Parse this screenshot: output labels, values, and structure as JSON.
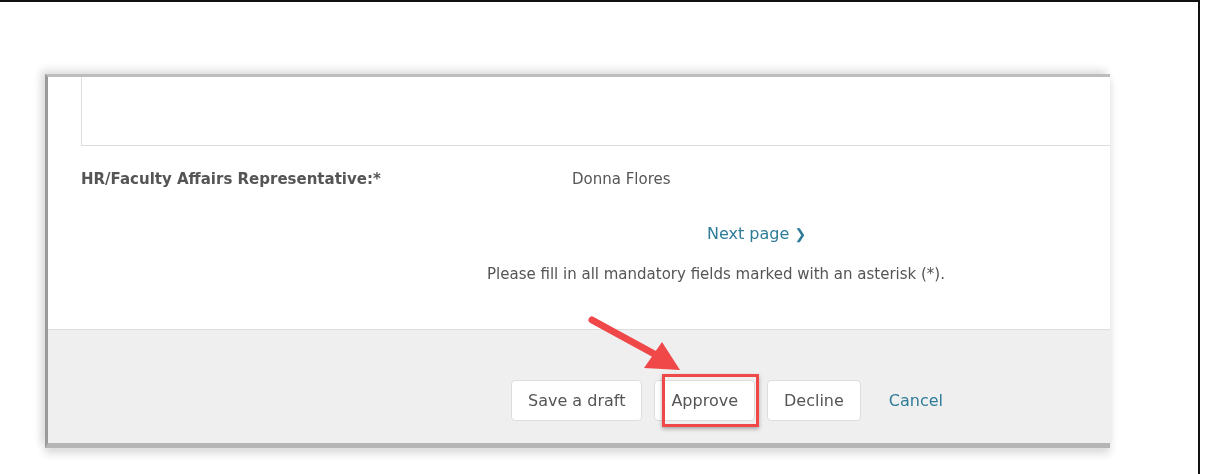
{
  "field": {
    "label": "HR/Faculty Affairs Representative:*",
    "value": "Donna Flores"
  },
  "next_page": {
    "label": "Next page",
    "icon": "❯"
  },
  "notice": "Please fill in all mandatory fields marked with an asterisk (*).",
  "actions": [
    {
      "label": "Save a draft",
      "kind": "button",
      "highlighted": false
    },
    {
      "label": "Approve",
      "kind": "button",
      "highlighted": true
    },
    {
      "label": "Decline",
      "kind": "button",
      "highlighted": false
    },
    {
      "label": "Cancel",
      "kind": "link",
      "highlighted": false
    }
  ]
}
